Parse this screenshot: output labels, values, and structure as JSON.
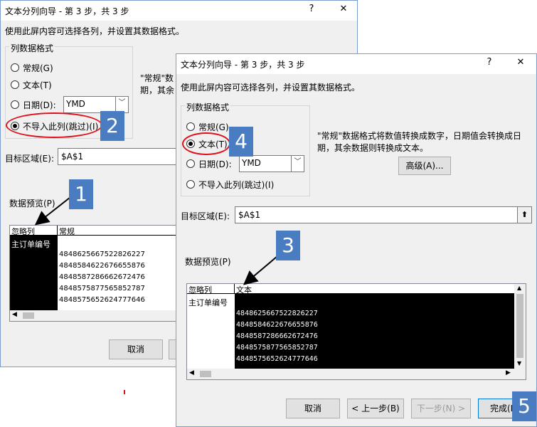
{
  "back": {
    "title": "文本分列向导 - 第 3 步，共 3 步",
    "help": "?",
    "close": "✕",
    "instruction": "使用此屏内容可选择各列，并设置其数据格式。",
    "group_title": "列数据格式",
    "opt_general": "常规(G)",
    "opt_text": "文本(T)",
    "opt_date": "日期(D):",
    "date_format": "YMD",
    "opt_skip": "不导入此列(跳过)(I)",
    "desc_line1": "\"常规\"数",
    "desc_line2": "期，其余",
    "dest_label": "目标区域(E):",
    "dest_value": "$A$1",
    "preview_label": "数据预览(P)",
    "col1_header": "忽略列",
    "col2_header": "常规",
    "cancel": "取消"
  },
  "front": {
    "title": "文本分列向导 - 第 3 步，共 3 步",
    "help": "?",
    "close": "✕",
    "instruction": "使用此屏内容可选择各列，并设置其数据格式。",
    "group_title": "列数据格式",
    "opt_general": "常规(G)",
    "opt_text": "文本(T)",
    "opt_date": "日期(D):",
    "date_format": "YMD",
    "opt_skip": "不导入此列(跳过)(I)",
    "desc_line1": "\"常规\"数据格式将数值转换成数字，日期值会转换成日",
    "desc_line2": "期，其余数据则转换成文本。",
    "advanced": "高级(A)...",
    "dest_label": "目标区域(E):",
    "dest_value": "$A$1",
    "preview_label": "数据预览(P)",
    "col1_header": "忽略列",
    "col2_header": "文本",
    "cancel": "取消",
    "prev": "< 上一步(B)",
    "next": "下一步(N) >",
    "finish": "完成(F)"
  },
  "preview_rows": {
    "header_cell": "主订单编号",
    "values": [
      "4848625667522826227",
      "4848584622676655876",
      "4848587286662672476",
      "4848575877565852787",
      "4848575652624777646"
    ]
  },
  "badges": [
    "1",
    "2",
    "3",
    "4",
    "5"
  ]
}
